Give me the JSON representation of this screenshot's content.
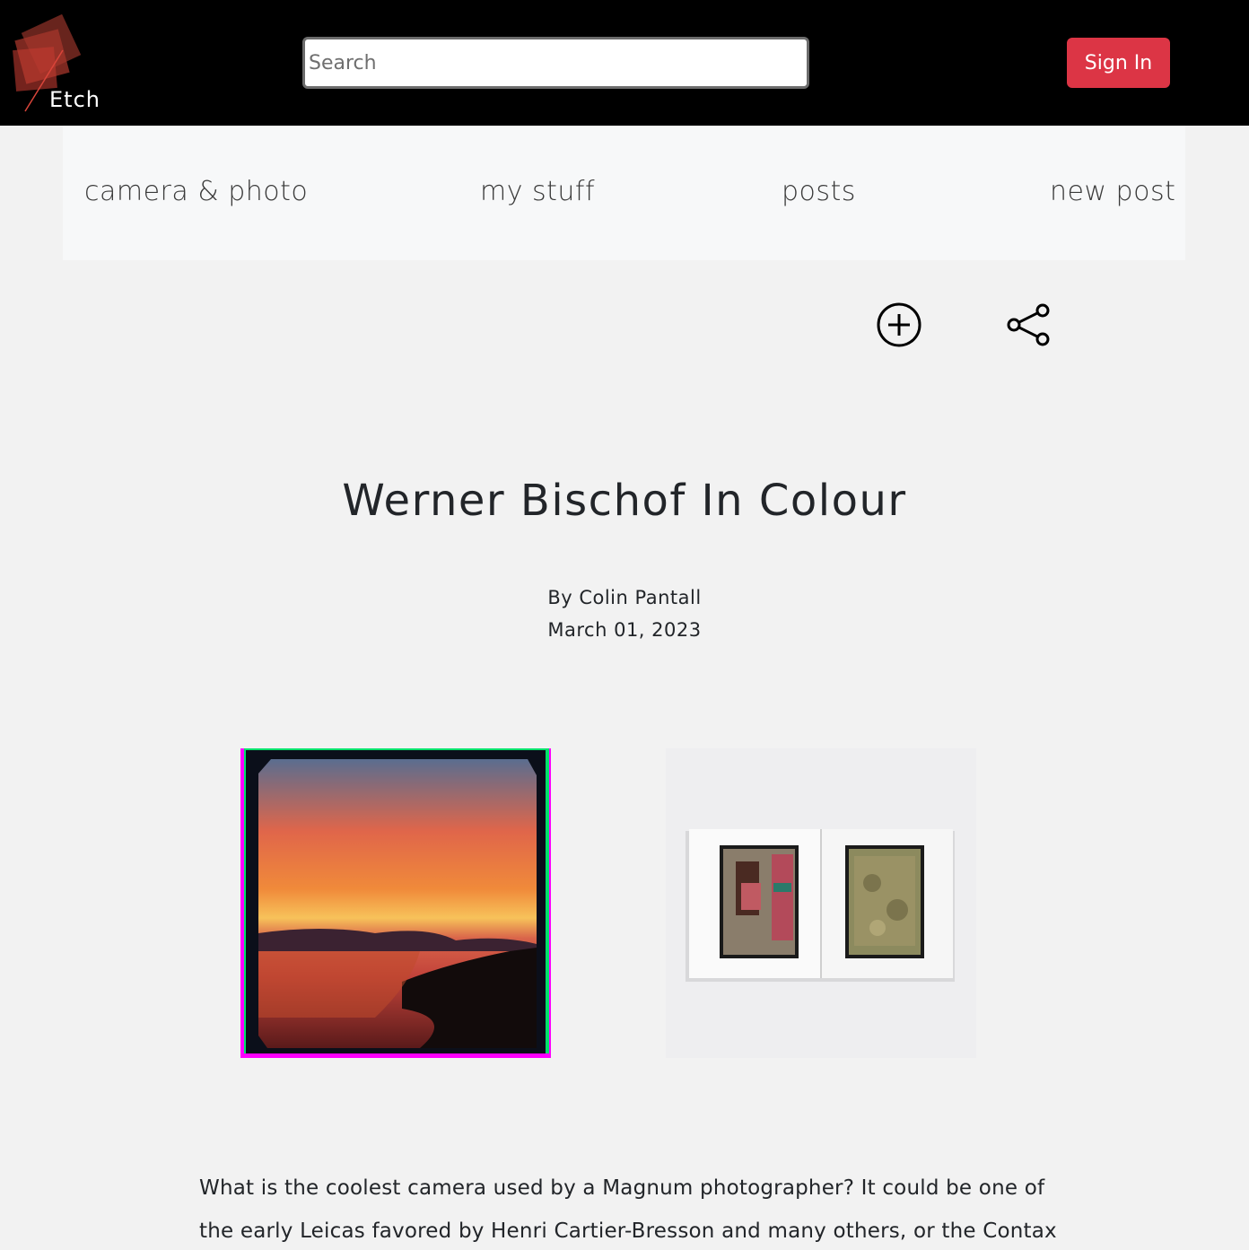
{
  "header": {
    "logo_text": "Etch",
    "search_placeholder": "Search",
    "sign_in_label": "Sign In"
  },
  "nav": {
    "items": [
      {
        "label": "camera & photo"
      },
      {
        "label": "my stuff"
      },
      {
        "label": "posts"
      },
      {
        "label": "new post"
      }
    ]
  },
  "article": {
    "title": "Werner Bischof In Colour",
    "author": "By Colin Pantall",
    "date": "March 01, 2023",
    "body": "What is the coolest camera used by a Magnum photographer? It could be one of the early Leicas favored by Henri Cartier-Bresson and many others, or the Contax II"
  },
  "icons": {
    "add": "plus-circle-icon",
    "share": "share-icon",
    "logo": "etch-logo-icon"
  },
  "colors": {
    "topbar": "#000000",
    "sign_in": "#dc3545",
    "nav_bg": "#f7f8f9",
    "page_bg": "#f2f2f2"
  }
}
